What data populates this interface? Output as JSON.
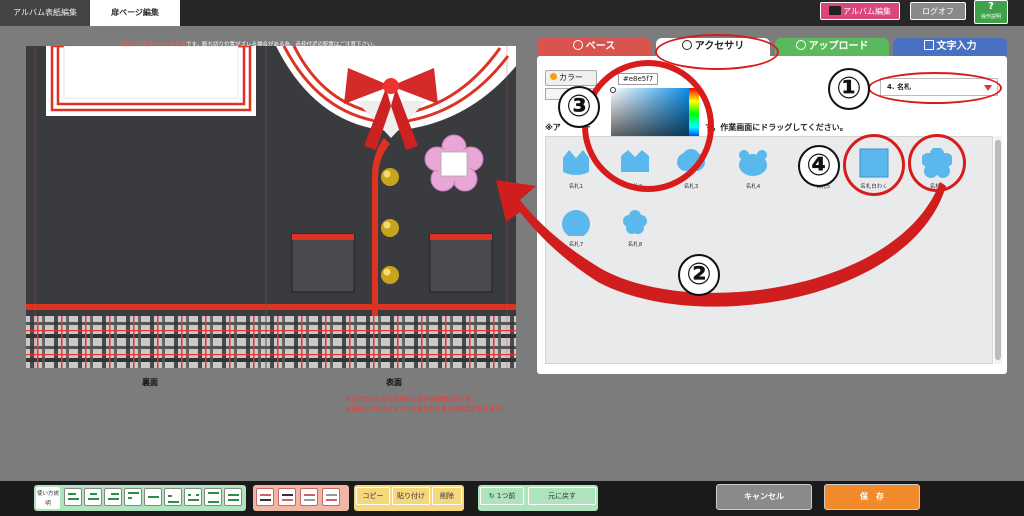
{
  "topbar": {
    "tab_album_cover": "アルバム表紙編集",
    "tab_inner_page": "扉ページ編集",
    "album_edit_button": "アルバム編集",
    "logout_button": "ログオフ",
    "help_button": "操作説明",
    "help_glyph": "?"
  },
  "canvas": {
    "warning_red": "赤枠が印刷後の仕上がり線",
    "warning_white": "です。断ち切り位置がズレる場合がある為、赤枠付近の配置はご注意下さい。",
    "label_back": "裏面",
    "label_front": "表面",
    "note_text_area": "※文字が入れられる部分は赤枠の範囲のみです。",
    "note_image_diff": "※出来上がりのイメージが見た目と異なる場合があります。"
  },
  "panel": {
    "tabs": {
      "base": "ベース",
      "accessory": "アクセサリ",
      "upload": "アップロード",
      "text_input": "文字入力"
    },
    "color_button": "カラー",
    "hex_value": "#e8e5f7",
    "instruction_left": "※ア",
    "instruction_dash": "ー",
    "instruction_right": "す。作業画面にドラッグしてください。",
    "category_select": "4. 名札",
    "items": [
      {
        "label": "名札1",
        "shape": "crown"
      },
      {
        "label": "名札2",
        "shape": "crown-wide"
      },
      {
        "label": "名札3",
        "shape": "cloud"
      },
      {
        "label": "名札4",
        "shape": "bear"
      },
      {
        "label": "名札5",
        "shape": "circle"
      },
      {
        "label": "名札白わく",
        "shape": "square"
      },
      {
        "label": "名札6",
        "shape": "flower"
      },
      {
        "label": "名札7",
        "shape": "circle-small"
      },
      {
        "label": "名札8",
        "shape": "flower-small"
      }
    ]
  },
  "annotations": {
    "n1": "①",
    "n2": "②",
    "n3": "③",
    "n4": "④"
  },
  "bottombar": {
    "usage_button": "使い方説明",
    "copy_button": "コピー",
    "paste_button": "貼り付け",
    "delete_button": "削除",
    "undo_button": "1つ前",
    "redo_button": "元に戻す",
    "cancel_button": "キャンセル",
    "save_button": "保　存"
  },
  "colors": {
    "accent_red": "#d81b1b",
    "tab_base": "#d9534f",
    "tab_upload": "#5cb85c",
    "tab_text": "#4a70c2",
    "item_blue": "#5bb8ec",
    "save_orange": "#f08a2b"
  }
}
